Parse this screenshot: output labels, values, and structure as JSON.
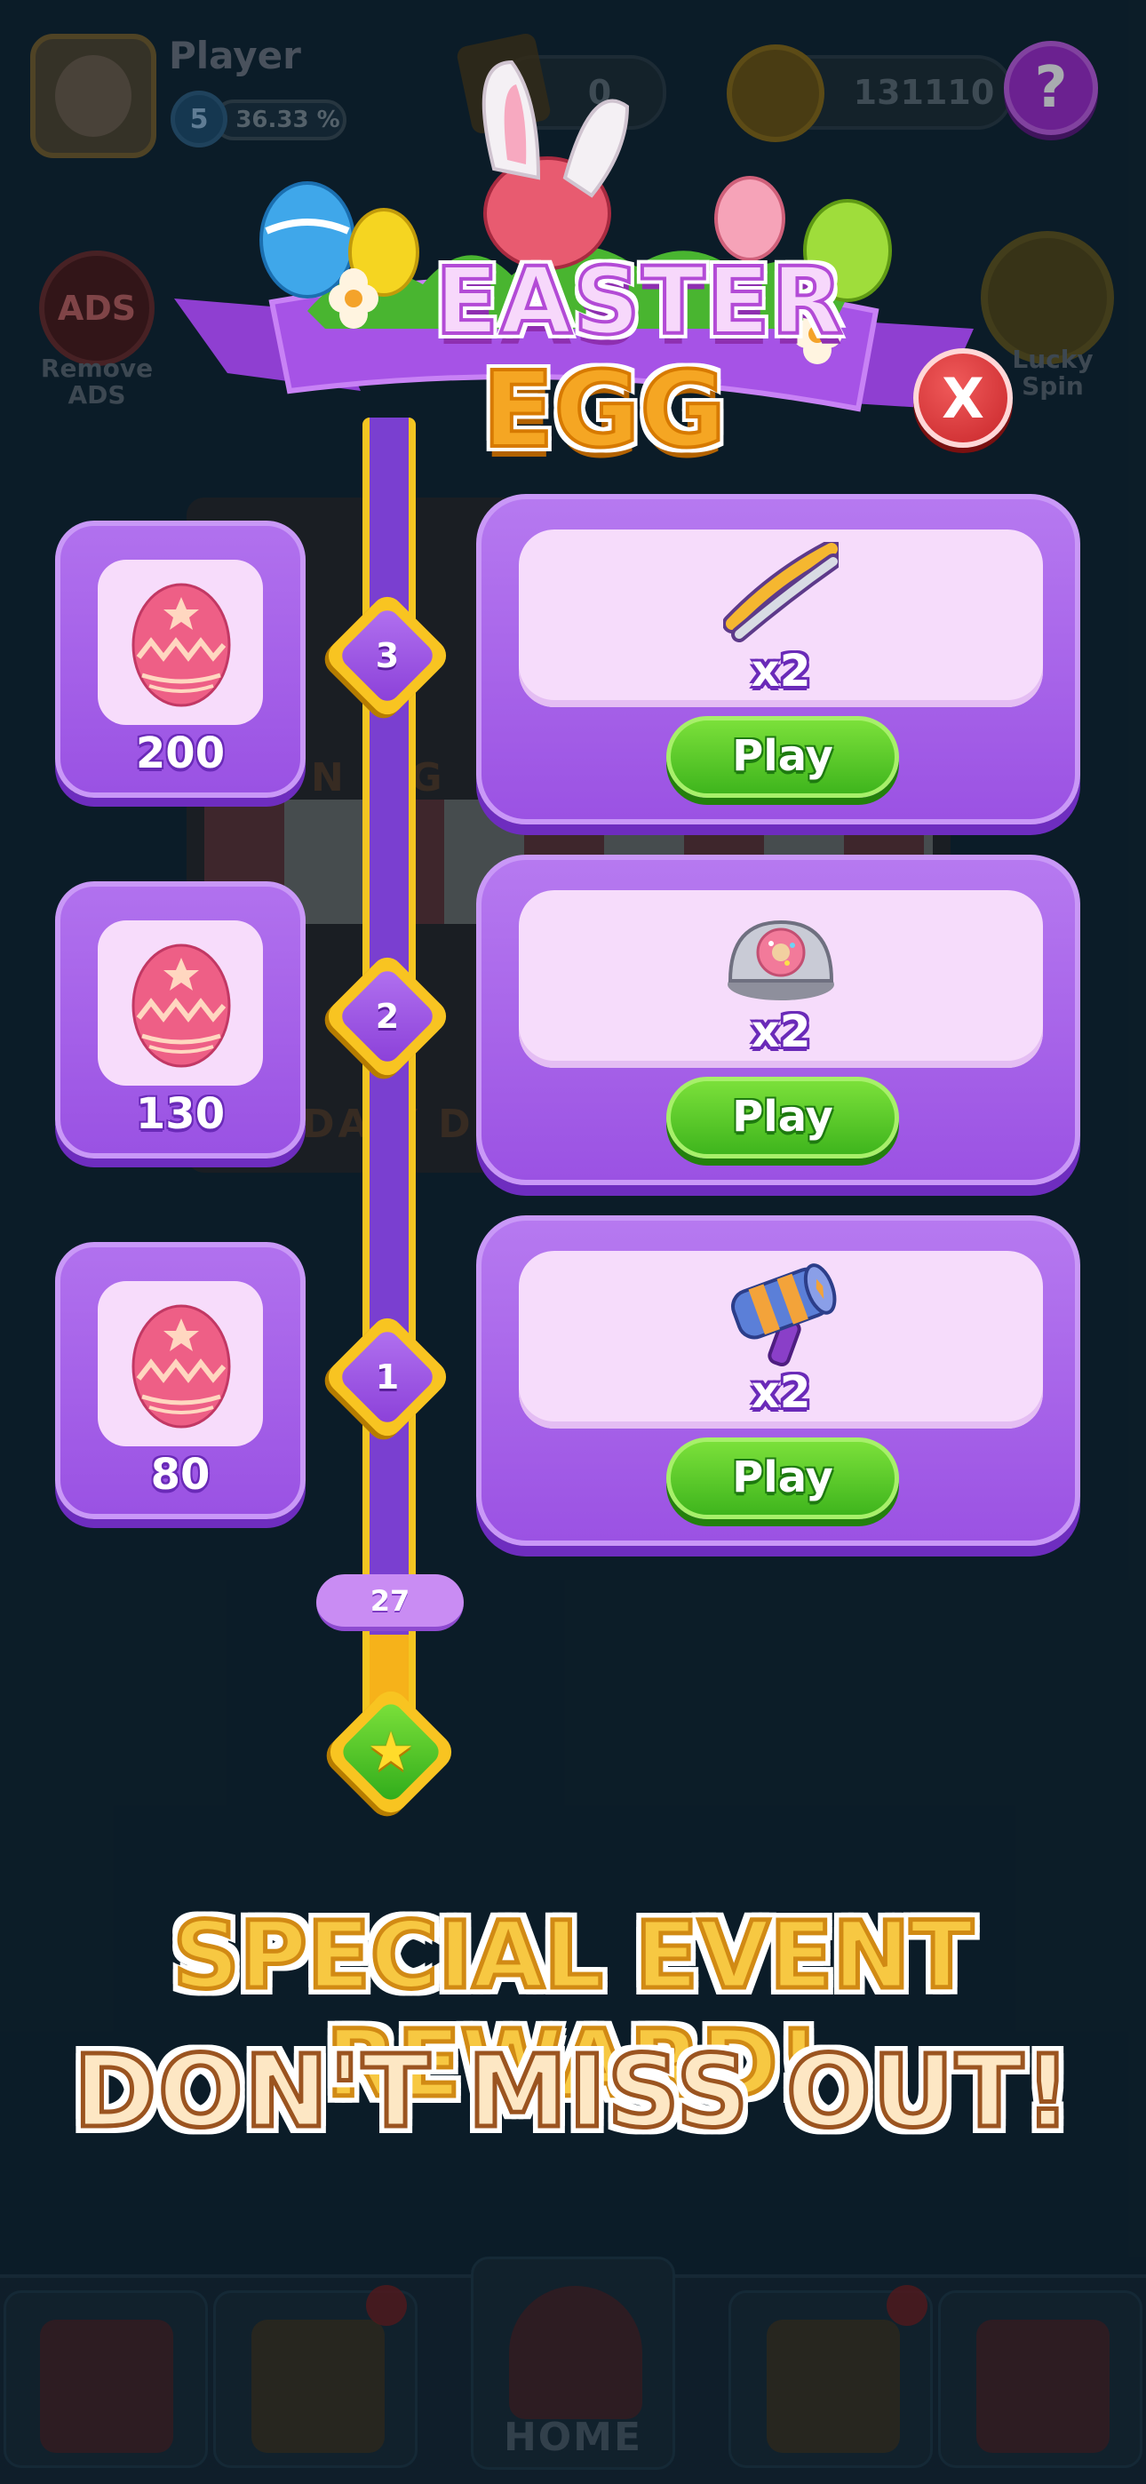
{
  "header": {
    "player_name": "Player",
    "level": "5",
    "xp_percent": "36.33 %",
    "tickets": "0",
    "coins": "131110",
    "help_label": "?",
    "remove_ads_badge": "ADS",
    "remove_ads_label": "Remove ADS",
    "lucky_spin_label": "Lucky Spin"
  },
  "background": {
    "store_sign": "N   L G",
    "store_sign_bottom": "DA   Y D"
  },
  "event": {
    "title_top": "EASTER",
    "title_bottom": "EGG",
    "close_label": "X",
    "progress_value": "27",
    "progress_star": "★",
    "levels": [
      {
        "number": "3",
        "reward_item": "tongs-booster",
        "reward_count": "x2",
        "play_label": "Play",
        "egg_points": "200"
      },
      {
        "number": "2",
        "reward_item": "donut-dish-booster",
        "reward_count": "x2",
        "play_label": "Play",
        "egg_points": "130"
      },
      {
        "number": "1",
        "reward_item": "hammer-booster",
        "reward_count": "x2",
        "play_label": "Play",
        "egg_points": "80"
      }
    ]
  },
  "promo": {
    "line1": "SPECIAL EVENT REWARD!",
    "line2": "DON'T MISS OUT!"
  },
  "nav": {
    "home_label": "HOME"
  },
  "colors": {
    "card_purple": "#9b52e3",
    "play_green": "#3fb51d",
    "track_gold": "#f4c521",
    "close_red": "#c8262a",
    "promo_gold": "#f7c842"
  }
}
